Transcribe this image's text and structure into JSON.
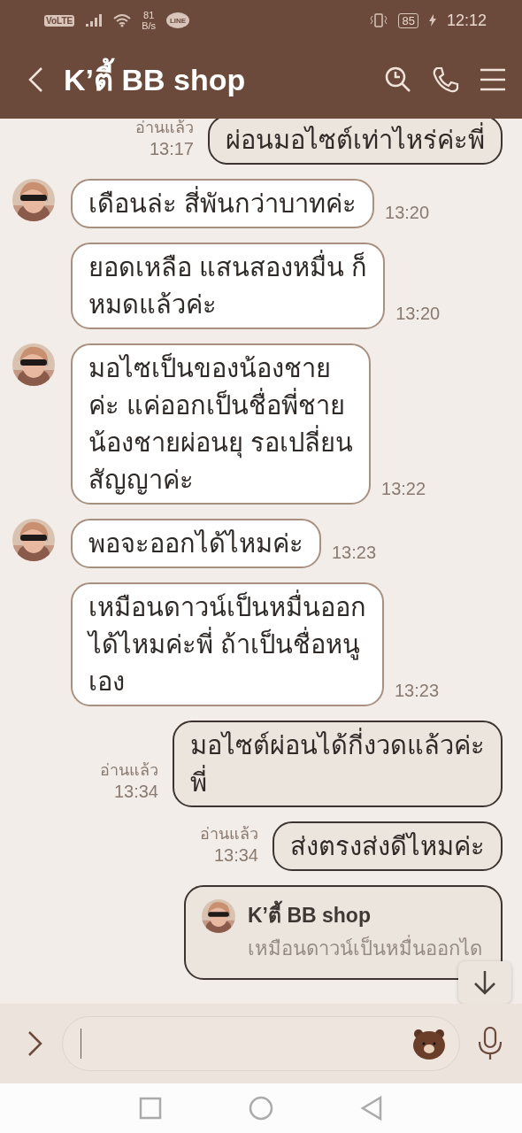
{
  "status_bar": {
    "volte": "VoLTE",
    "app_badge": "LINE",
    "speed_value": "81",
    "speed_unit": "B/s",
    "battery": "85",
    "time": "12:12"
  },
  "header": {
    "title": "K’ตี้ BB shop"
  },
  "messages": [
    {
      "kind": "outgoing",
      "read": "อ่านแล้ว",
      "time": "13:17",
      "lines": [
        "ผ่อนมอไซต์เท่าไหร่ค่ะพี่"
      ]
    },
    {
      "kind": "incoming",
      "avatar": true,
      "time": "13:20",
      "lines": [
        "เดือนล่ะ สี่พันกว่าบาทค่ะ"
      ]
    },
    {
      "kind": "incoming",
      "avatar": false,
      "time": "13:20",
      "lines": [
        "ยอดเหลือ แสนสองหมื่น ก็",
        "หมดแล้วค่ะ"
      ]
    },
    {
      "kind": "incoming",
      "avatar": true,
      "time": "13:22",
      "lines": [
        "มอไซเป็นของน้องชาย",
        "ค่ะ แค่ออกเป็นชื่อพี่ชาย",
        "น้องชายผ่อนยุ รอเปลี่ยน",
        "สัญญาค่ะ"
      ]
    },
    {
      "kind": "incoming",
      "avatar": true,
      "time": "13:23",
      "lines": [
        "พอจะออกได้ไหมค่ะ"
      ]
    },
    {
      "kind": "incoming",
      "avatar": false,
      "time": "13:23",
      "lines": [
        "เหมือนดาวน์เป็นหมื่นออก",
        "ได้ไหมค่ะพี่ ถ้าเป็นชื่อหนู",
        "เอง"
      ]
    },
    {
      "kind": "outgoing",
      "read": "อ่านแล้ว",
      "time": "13:34",
      "lines": [
        "มอไซต์ผ่อนได้กี่งวดแล้วค่ะ",
        "พี่"
      ]
    },
    {
      "kind": "outgoing",
      "read": "อ่านแล้ว",
      "time": "13:34",
      "lines": [
        "ส่งตรงส่งดีไหมค่ะ"
      ]
    },
    {
      "kind": "reply",
      "quote_name": "K’ตี้ BB shop",
      "quote_text": "เหมือนดาวน์เป็นหมื่นออกได"
    }
  ]
}
